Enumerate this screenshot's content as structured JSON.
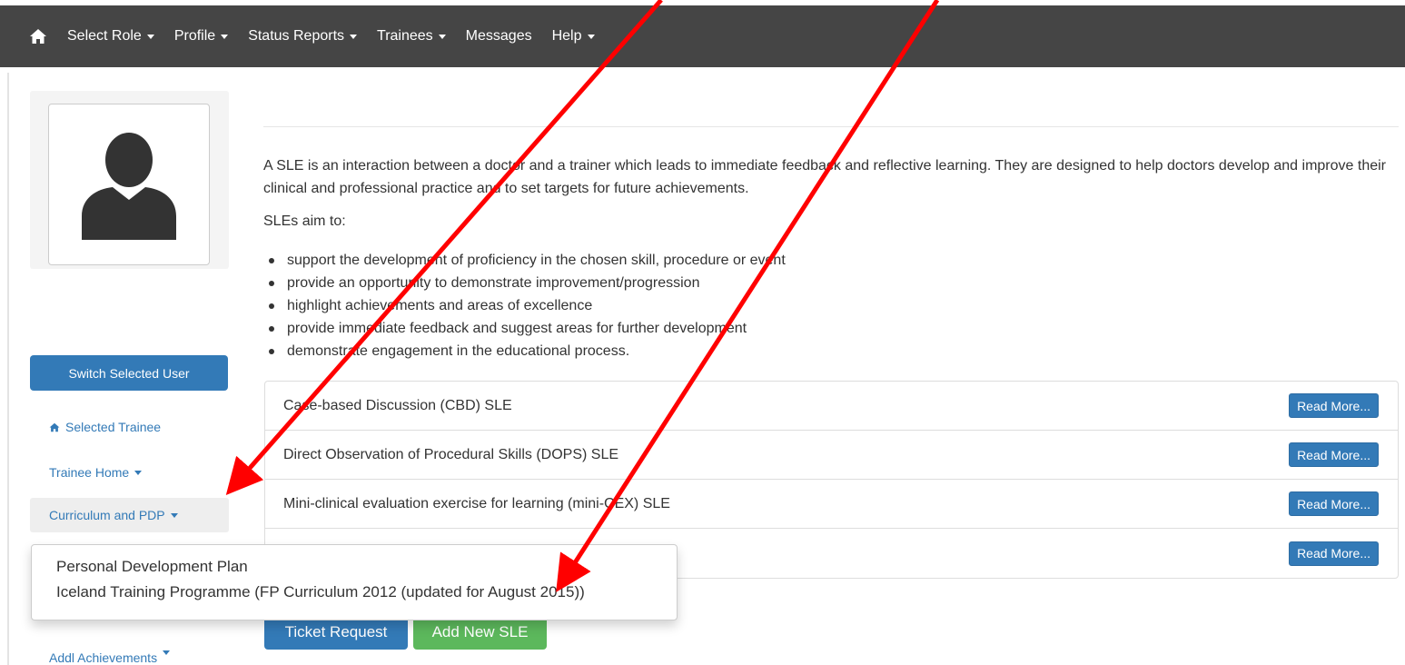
{
  "navbar": {
    "home_icon": "home-icon",
    "items": [
      {
        "label": "Select Role",
        "dropdown": true
      },
      {
        "label": "Profile",
        "dropdown": true
      },
      {
        "label": "Status Reports",
        "dropdown": true
      },
      {
        "label": "Trainees",
        "dropdown": true
      },
      {
        "label": "Messages",
        "dropdown": false
      },
      {
        "label": "Help",
        "dropdown": true
      }
    ],
    "background": "#454545"
  },
  "sidebar": {
    "avatar_icon": "user-silhouette-icon",
    "switch_button": "Switch Selected User",
    "links": [
      {
        "label": "Selected Trainee",
        "icon": "home-icon"
      },
      {
        "label": "Trainee Home",
        "dropdown": true
      },
      {
        "label": "Curriculum and PDP",
        "dropdown": true,
        "active": true
      },
      {
        "label": "Addl Achievements",
        "dropdown": true
      }
    ]
  },
  "dropdown": {
    "items": [
      "Personal Development Plan",
      "Iceland Training Programme (FP Curriculum 2012 (updated for August 2015))"
    ]
  },
  "main": {
    "intro": "A SLE is an interaction between a doctor and a trainer which leads to immediate feedback and reflective learning. They are designed to help doctors develop and improve their clinical and professional practice and to set targets for future achievements.",
    "aims_heading": "SLEs aim to:",
    "aims": [
      "support the development of proficiency in the chosen skill, procedure or event",
      "provide an opportunity to demonstrate improvement/progression",
      "highlight achievements and areas of excellence",
      "provide immediate feedback and suggest areas for further development",
      "demonstrate engagement in the educational process."
    ],
    "sle_types": [
      {
        "label": "Case-based Discussion (CBD) SLE",
        "button": "Read More..."
      },
      {
        "label": "Direct Observation of Procedural Skills (DOPS) SLE",
        "button": "Read More..."
      },
      {
        "label": "Mini-clinical evaluation exercise for learning (mini-CEX) SLE",
        "button": "Read More..."
      },
      {
        "label": "",
        "button": "Read More..."
      }
    ],
    "ticket_button": "Ticket Request",
    "add_button": "Add New SLE"
  },
  "colors": {
    "primary": "#337ab7",
    "success": "#5cb85c",
    "annotation_arrow": "#ff0000"
  }
}
